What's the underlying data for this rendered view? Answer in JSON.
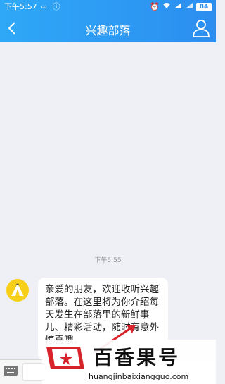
{
  "status_bar": {
    "time": "下午5:57",
    "left_icons": [
      "infinity-icon",
      "alert-icon"
    ],
    "right_icons": [
      "alarm-icon",
      "wifi-icon",
      "signal-icon",
      "signal-icon"
    ],
    "battery": "84"
  },
  "header": {
    "title": "兴趣部落",
    "back_icon": "chevron-left-icon",
    "profile_icon": "person-icon"
  },
  "conversation": {
    "timestamp": "下午5:55",
    "message": {
      "sender_avatar": "tent-icon",
      "text": "亲爱的朋友，欢迎收听兴趣部落。在这里将为你介绍每天发生在部落里的新鲜事儿、精彩活动，随时有意外惊喜哦。"
    }
  },
  "input_bar": {
    "keyboard_icon": "keyboard-icon"
  },
  "watermark": {
    "title": "百香果号",
    "url": "huangjinbaixiangguo.com"
  },
  "colors": {
    "header_blue": "#2c8ef0",
    "background": "#eef0f5",
    "avatar_yellow": "#f7cf19",
    "watermark_red": "#d8232a"
  }
}
